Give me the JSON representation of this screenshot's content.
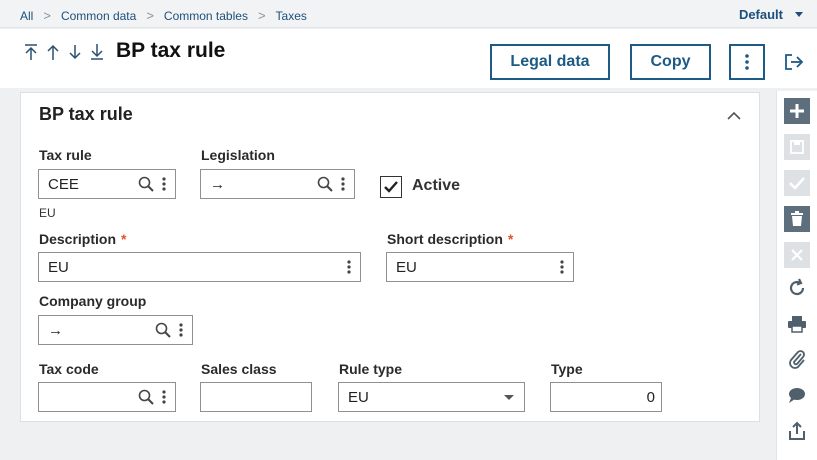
{
  "breadcrumb": {
    "items": [
      "All",
      "Common data",
      "Common tables",
      "Taxes"
    ],
    "separator": ">",
    "profile": "Default"
  },
  "header": {
    "title": "BP tax rule",
    "buttons": {
      "legal": "Legal data",
      "copy": "Copy"
    },
    "nav_icons": [
      "arrow-up-to-top-icon",
      "arrow-up-icon",
      "arrow-down-icon",
      "arrow-down-to-bottom-icon"
    ]
  },
  "section": {
    "title": "BP tax rule",
    "fields": {
      "tax_rule": {
        "label": "Tax rule",
        "value": "CEE",
        "hint": "EU"
      },
      "legislation": {
        "label": "Legislation",
        "value": "→"
      },
      "active": {
        "label": "Active",
        "checked": true
      },
      "description": {
        "label": "Description",
        "value": "EU",
        "required_mark": "*"
      },
      "short_description": {
        "label": "Short description",
        "value": "EU",
        "required_mark": "*"
      },
      "company_group": {
        "label": "Company group",
        "value": "→"
      },
      "tax_code": {
        "label": "Tax code",
        "value": ""
      },
      "sales_class": {
        "label": "Sales class",
        "value": ""
      },
      "rule_type": {
        "label": "Rule type",
        "value": "EU"
      },
      "type": {
        "label": "Type",
        "value": "0"
      }
    }
  },
  "sidebar_icons": [
    "add-icon",
    "save-icon",
    "check-icon",
    "delete-icon",
    "cancel-icon",
    "refresh-icon",
    "print-icon",
    "attachment-icon",
    "comment-icon",
    "export-icon"
  ],
  "colors": {
    "accent": "#1d5a85",
    "required": "#e0532c",
    "sidebar_button": "#5d6e7c"
  }
}
